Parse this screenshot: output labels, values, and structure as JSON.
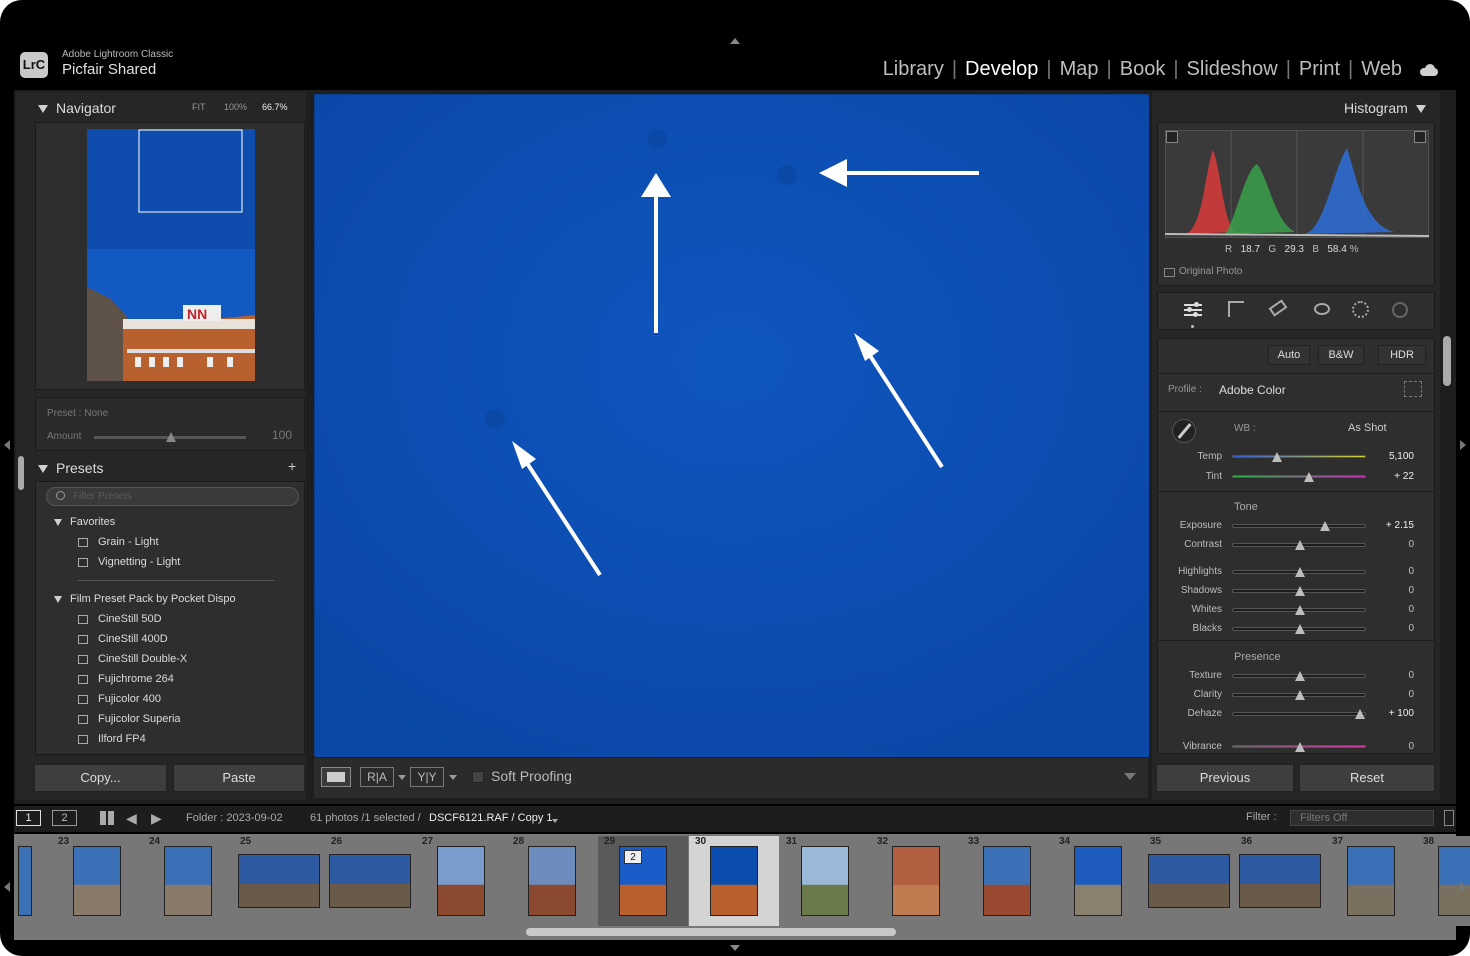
{
  "app": {
    "name": "Adobe Lightroom Classic",
    "catalog": "Picfair Shared",
    "logo": "LrC"
  },
  "modules": [
    "Library",
    "Develop",
    "Map",
    "Book",
    "Slideshow",
    "Print",
    "Web"
  ],
  "active_module": "Develop",
  "navigator": {
    "title": "Navigator",
    "zoom": [
      "FIT",
      "100%",
      "66.7%"
    ]
  },
  "quick_preset": {
    "preset": "Preset : None",
    "amount_label": "Amount",
    "amount_value": "100"
  },
  "presets": {
    "title": "Presets",
    "filter_placeholder": "Filter Presets",
    "groups": [
      {
        "name": "Favorites",
        "items": [
          "Grain - Light",
          "Vignetting - Light"
        ]
      },
      {
        "name": "Film Preset Pack by Pocket Dispo",
        "items": [
          "CineStill 50D",
          "CineStill 400D",
          "CineStill Double-X",
          "Fujichrome 264",
          "Fujicolor 400",
          "Fujicolor Superia",
          "Ilford FP4"
        ]
      }
    ]
  },
  "left_buttons": {
    "copy": "Copy...",
    "paste": "Paste"
  },
  "toolbar": {
    "soft_proofing": "Soft Proofing",
    "ra": "R|A",
    "yy": "Y|Y"
  },
  "histogram": {
    "title": "Histogram",
    "r_label": "R",
    "r": "18.7",
    "g_label": "G",
    "g": "29.3",
    "b_label": "B",
    "b": "58.4",
    "pct": "%",
    "original_photo": "Original Photo"
  },
  "basic": {
    "auto": "Auto",
    "bw": "B&W",
    "hdr": "HDR",
    "profile_label": "Profile :",
    "profile_value": "Adobe Color",
    "wb_label": "WB :",
    "wb_value": "As Shot",
    "tone_title": "Tone",
    "presence_title": "Presence",
    "sliders": [
      {
        "label": "Temp",
        "value": "5,100",
        "pos": 0.33
      },
      {
        "label": "Tint",
        "value": "+ 22",
        "pos": 0.57
      },
      {
        "label": "Exposure",
        "value": "+ 2.15",
        "pos": 0.69
      },
      {
        "label": "Contrast",
        "value": "0",
        "pos": 0.5
      },
      {
        "label": "Highlights",
        "value": "0",
        "pos": 0.5
      },
      {
        "label": "Shadows",
        "value": "0",
        "pos": 0.5
      },
      {
        "label": "Whites",
        "value": "0",
        "pos": 0.5
      },
      {
        "label": "Blacks",
        "value": "0",
        "pos": 0.5
      },
      {
        "label": "Texture",
        "value": "0",
        "pos": 0.5
      },
      {
        "label": "Clarity",
        "value": "0",
        "pos": 0.5
      },
      {
        "label": "Dehaze",
        "value": "+ 100",
        "pos": 0.95
      },
      {
        "label": "Vibrance",
        "value": "0",
        "pos": 0.5
      }
    ]
  },
  "right_buttons": {
    "previous": "Previous",
    "reset": "Reset"
  },
  "filmstrip_bar": {
    "page1": "1",
    "page2": "2",
    "folder": "Folder : 2023-09-02",
    "count": "61 photos /1 selected /",
    "filename": "DSCF6121.RAF / Copy 1",
    "filter_label": "Filter :",
    "filter_value": "Filters Off"
  },
  "filmstrip": [
    "23",
    "24",
    "25",
    "26",
    "27",
    "28",
    "29",
    "30",
    "31",
    "32",
    "33",
    "34",
    "35",
    "36",
    "37",
    "38"
  ],
  "stack_badge": "2",
  "colors": {
    "sky": "#0a4fb0",
    "panel": "#2b2b2b",
    "bg": "#1a1a1a"
  }
}
